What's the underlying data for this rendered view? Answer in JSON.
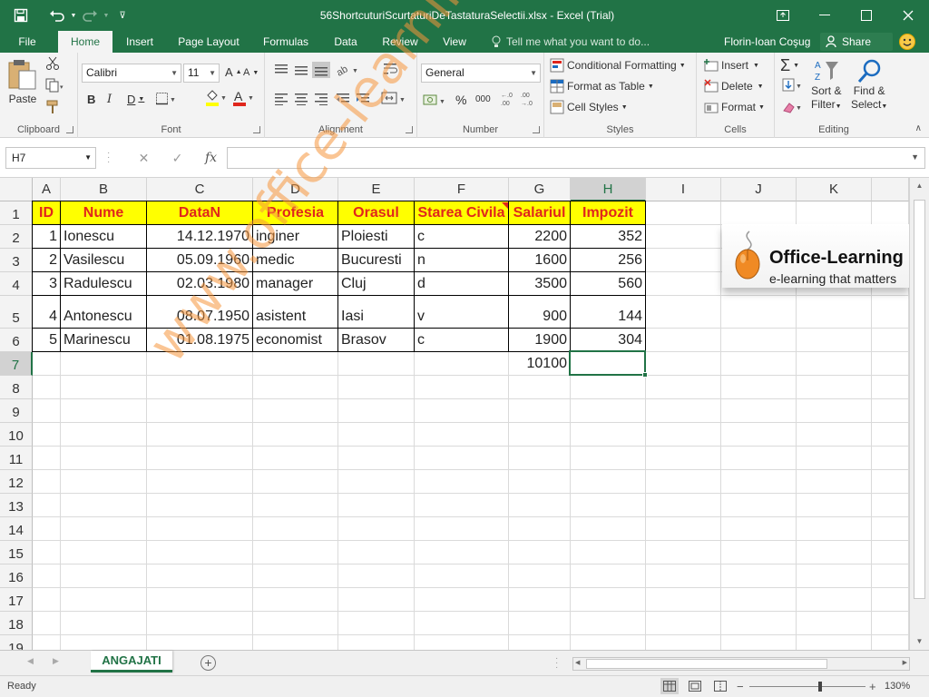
{
  "window": {
    "title": "56ShortcuturiScurtaturiDeTastaturaSelectii.xlsx - Excel (Trial)"
  },
  "ribbon_tabs": [
    "File",
    "Home",
    "Insert",
    "Page Layout",
    "Formulas",
    "Data",
    "Review",
    "View"
  ],
  "tell_me": "Tell me what you want to do...",
  "user": "Florin-Ioan Coşug",
  "share_label": "Share",
  "ribbon": {
    "clipboard": {
      "label": "Clipboard",
      "paste": "Paste"
    },
    "font": {
      "label": "Font",
      "name": "Calibri",
      "size": "11",
      "bold": "B",
      "italic": "I",
      "underline": "D"
    },
    "alignment": {
      "label": "Alignment"
    },
    "number": {
      "label": "Number",
      "format": "General",
      "percent": "%",
      "comma": "000"
    },
    "styles": {
      "label": "Styles",
      "conditional": "Conditional Formatting",
      "format_table": "Format as Table",
      "cell_styles": "Cell Styles"
    },
    "cells": {
      "label": "Cells",
      "insert": "Insert",
      "delete": "Delete",
      "format": "Format"
    },
    "editing": {
      "label": "Editing",
      "sort": "Sort &",
      "filter": "Filter",
      "find": "Find &",
      "select": "Select"
    }
  },
  "formula_bar": {
    "name_box": "H7",
    "fx": "fx",
    "value": ""
  },
  "columns": [
    "A",
    "B",
    "C",
    "D",
    "E",
    "F",
    "G",
    "H",
    "I",
    "J",
    "K"
  ],
  "rows": [
    "1",
    "2",
    "3",
    "4",
    "5",
    "6",
    "7",
    "8",
    "9",
    "10",
    "11",
    "12",
    "13",
    "14",
    "15",
    "16",
    "17",
    "18",
    "19"
  ],
  "table": {
    "headers": [
      "ID",
      "Nume",
      "DataN",
      "Profesia",
      "Orasul",
      "Starea Civila",
      "Salariul",
      "Impozit"
    ],
    "rows": [
      [
        "1",
        "Ionescu",
        "14.12.1970",
        "inginer",
        "Ploiesti",
        "c",
        "2200",
        "352"
      ],
      [
        "2",
        "Vasilescu",
        "05.09.1960",
        "medic",
        "Bucuresti",
        "n",
        "1600",
        "256"
      ],
      [
        "3",
        "Radulescu",
        "02.03.1980",
        "manager",
        "Cluj",
        "d",
        "3500",
        "560"
      ],
      [
        "4",
        "Antonescu",
        "08.07.1950",
        "asistent",
        "Iasi",
        "v",
        "900",
        "144"
      ],
      [
        "5",
        "Marinescu",
        "01.08.1975",
        "economist",
        "Brasov",
        "c",
        "1900",
        "304"
      ]
    ],
    "total_salary": "10100"
  },
  "logo": {
    "title": "Office-Learning",
    "tagline": "e-learning that matters"
  },
  "watermark": "www.office-learning.ro",
  "sheet_tab": "ANGAJATI",
  "status": {
    "ready": "Ready",
    "zoom": "130%"
  },
  "colors": {
    "excel_green": "#217346",
    "header_fill": "#ffff00",
    "header_text": "#e0261c"
  }
}
